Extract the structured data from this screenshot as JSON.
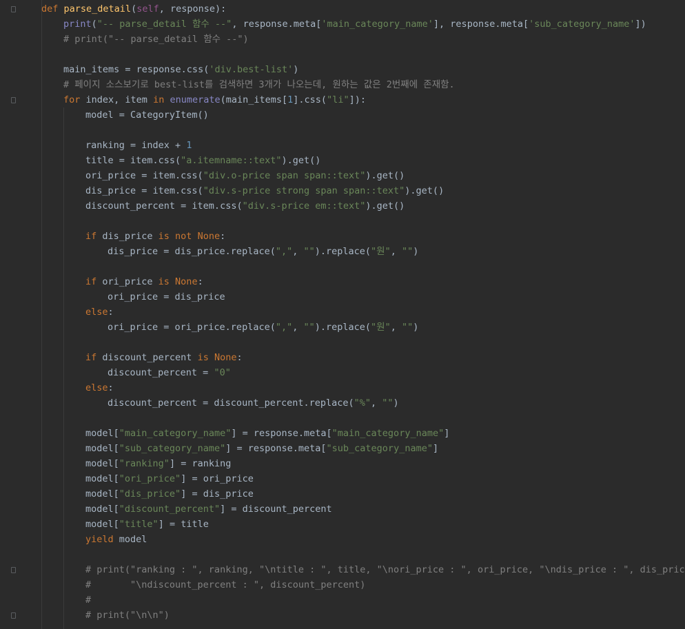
{
  "editor": {
    "lines": [
      {
        "indent": 0,
        "tokens": [
          [
            "keyword",
            "def "
          ],
          [
            "func",
            "parse_detail"
          ],
          [
            "text",
            "("
          ],
          [
            "self",
            "self"
          ],
          [
            "text",
            ", response):"
          ]
        ]
      },
      {
        "indent": 1,
        "tokens": [
          [
            "builtin",
            "print"
          ],
          [
            "text",
            "("
          ],
          [
            "string",
            "\"-- parse_detail 함수 --\""
          ],
          [
            "text",
            ", response.meta["
          ],
          [
            "string",
            "'main_category_name'"
          ],
          [
            "text",
            "], response.meta["
          ],
          [
            "string",
            "'sub_category_name'"
          ],
          [
            "text",
            "])"
          ]
        ]
      },
      {
        "indent": 1,
        "tokens": [
          [
            "comment",
            "# print(\"-- parse_detail 함수 --\")"
          ]
        ]
      },
      {
        "indent": 0,
        "tokens": []
      },
      {
        "indent": 1,
        "tokens": [
          [
            "text",
            "main_items = response.css("
          ],
          [
            "string",
            "'div.best-list'"
          ],
          [
            "text",
            ")"
          ]
        ]
      },
      {
        "indent": 1,
        "tokens": [
          [
            "comment",
            "# 페이지 소스보기로 best-list를 검색하면 3개가 나오는데, 원하는 값은 2번째에 존재함."
          ]
        ]
      },
      {
        "indent": 1,
        "tokens": [
          [
            "keyword",
            "for "
          ],
          [
            "text",
            "index, item "
          ],
          [
            "keyword",
            "in "
          ],
          [
            "builtin",
            "enumerate"
          ],
          [
            "text",
            "(main_items["
          ],
          [
            "number",
            "1"
          ],
          [
            "text",
            "].css("
          ],
          [
            "string",
            "\"li\""
          ],
          [
            "text",
            "]):"
          ]
        ]
      },
      {
        "indent": 2,
        "tokens": [
          [
            "text",
            "model = CategoryItem()"
          ]
        ]
      },
      {
        "indent": 0,
        "tokens": []
      },
      {
        "indent": 2,
        "tokens": [
          [
            "text",
            "ranking = index + "
          ],
          [
            "number",
            "1"
          ]
        ]
      },
      {
        "indent": 2,
        "tokens": [
          [
            "text",
            "title = item.css("
          ],
          [
            "string",
            "\"a.itemname::text\""
          ],
          [
            "text",
            ").get()"
          ]
        ]
      },
      {
        "indent": 2,
        "tokens": [
          [
            "text",
            "ori_price = item.css("
          ],
          [
            "string",
            "\"div.o-price span span::text\""
          ],
          [
            "text",
            ").get()"
          ]
        ]
      },
      {
        "indent": 2,
        "tokens": [
          [
            "text",
            "dis_price = item.css("
          ],
          [
            "string",
            "\"div.s-price strong span span::text\""
          ],
          [
            "text",
            ").get()"
          ]
        ]
      },
      {
        "indent": 2,
        "tokens": [
          [
            "text",
            "discount_percent = item.css("
          ],
          [
            "string",
            "\"div.s-price em::text\""
          ],
          [
            "text",
            ").get()"
          ]
        ]
      },
      {
        "indent": 0,
        "tokens": []
      },
      {
        "indent": 2,
        "tokens": [
          [
            "keyword",
            "if "
          ],
          [
            "text",
            "dis_price "
          ],
          [
            "keyword",
            "is not None"
          ],
          [
            "text",
            ":"
          ]
        ]
      },
      {
        "indent": 3,
        "tokens": [
          [
            "text",
            "dis_price = dis_price.replace("
          ],
          [
            "string",
            "\",\""
          ],
          [
            "text",
            ", "
          ],
          [
            "string",
            "\"\""
          ],
          [
            "text",
            ").replace("
          ],
          [
            "string",
            "\"원\""
          ],
          [
            "text",
            ", "
          ],
          [
            "string",
            "\"\""
          ],
          [
            "text",
            ")"
          ]
        ]
      },
      {
        "indent": 0,
        "tokens": []
      },
      {
        "indent": 2,
        "tokens": [
          [
            "keyword",
            "if "
          ],
          [
            "text",
            "ori_price "
          ],
          [
            "keyword",
            "is None"
          ],
          [
            "text",
            ":"
          ]
        ]
      },
      {
        "indent": 3,
        "tokens": [
          [
            "text",
            "ori_price = dis_price"
          ]
        ]
      },
      {
        "indent": 2,
        "tokens": [
          [
            "keyword",
            "else"
          ],
          [
            "text",
            ":"
          ]
        ]
      },
      {
        "indent": 3,
        "tokens": [
          [
            "text",
            "ori_price = ori_price.replace("
          ],
          [
            "string",
            "\",\""
          ],
          [
            "text",
            ", "
          ],
          [
            "string",
            "\"\""
          ],
          [
            "text",
            ").replace("
          ],
          [
            "string",
            "\"원\""
          ],
          [
            "text",
            ", "
          ],
          [
            "string",
            "\"\""
          ],
          [
            "text",
            ")"
          ]
        ]
      },
      {
        "indent": 0,
        "tokens": []
      },
      {
        "indent": 2,
        "tokens": [
          [
            "keyword",
            "if "
          ],
          [
            "text",
            "discount_percent "
          ],
          [
            "keyword",
            "is None"
          ],
          [
            "text",
            ":"
          ]
        ]
      },
      {
        "indent": 3,
        "tokens": [
          [
            "text",
            "discount_percent = "
          ],
          [
            "string",
            "\"0\""
          ]
        ]
      },
      {
        "indent": 2,
        "tokens": [
          [
            "keyword",
            "else"
          ],
          [
            "text",
            ":"
          ]
        ]
      },
      {
        "indent": 3,
        "tokens": [
          [
            "text",
            "discount_percent = discount_percent.replace("
          ],
          [
            "string",
            "\"%\""
          ],
          [
            "text",
            ", "
          ],
          [
            "string",
            "\"\""
          ],
          [
            "text",
            ")"
          ]
        ]
      },
      {
        "indent": 0,
        "tokens": []
      },
      {
        "indent": 2,
        "tokens": [
          [
            "text",
            "model["
          ],
          [
            "string",
            "\"main_category_name\""
          ],
          [
            "text",
            "] = response.meta["
          ],
          [
            "string",
            "\"main_category_name\""
          ],
          [
            "text",
            "]"
          ]
        ]
      },
      {
        "indent": 2,
        "tokens": [
          [
            "text",
            "model["
          ],
          [
            "string",
            "\"sub_category_name\""
          ],
          [
            "text",
            "] = response.meta["
          ],
          [
            "string",
            "\"sub_category_name\""
          ],
          [
            "text",
            "]"
          ]
        ]
      },
      {
        "indent": 2,
        "tokens": [
          [
            "text",
            "model["
          ],
          [
            "string",
            "\"ranking\""
          ],
          [
            "text",
            "] = ranking"
          ]
        ]
      },
      {
        "indent": 2,
        "tokens": [
          [
            "text",
            "model["
          ],
          [
            "string",
            "\"ori_price\""
          ],
          [
            "text",
            "] = ori_price"
          ]
        ]
      },
      {
        "indent": 2,
        "tokens": [
          [
            "text",
            "model["
          ],
          [
            "string",
            "\"dis_price\""
          ],
          [
            "text",
            "] = dis_price"
          ]
        ]
      },
      {
        "indent": 2,
        "tokens": [
          [
            "text",
            "model["
          ],
          [
            "string",
            "\"discount_percent\""
          ],
          [
            "text",
            "] = discount_percent"
          ]
        ]
      },
      {
        "indent": 2,
        "tokens": [
          [
            "text",
            "model["
          ],
          [
            "string",
            "\"title\""
          ],
          [
            "text",
            "] = title"
          ]
        ]
      },
      {
        "indent": 2,
        "tokens": [
          [
            "keyword",
            "yield "
          ],
          [
            "text",
            "model"
          ]
        ]
      },
      {
        "indent": 0,
        "tokens": []
      },
      {
        "indent": 2,
        "tokens": [
          [
            "comment",
            "# print(\"ranking : \", ranking, \"\\ntitle : \", title, \"\\nori_price : \", ori_price, \"\\ndis_price : \", dis_price,"
          ]
        ]
      },
      {
        "indent": 2,
        "tokens": [
          [
            "comment",
            "#       \"\\ndiscount_percent : \", discount_percent)"
          ]
        ]
      },
      {
        "indent": 2,
        "tokens": [
          [
            "comment",
            "#"
          ]
        ]
      },
      {
        "indent": 2,
        "tokens": [
          [
            "comment",
            "# print(\"\\n\\n\")"
          ]
        ]
      }
    ]
  }
}
